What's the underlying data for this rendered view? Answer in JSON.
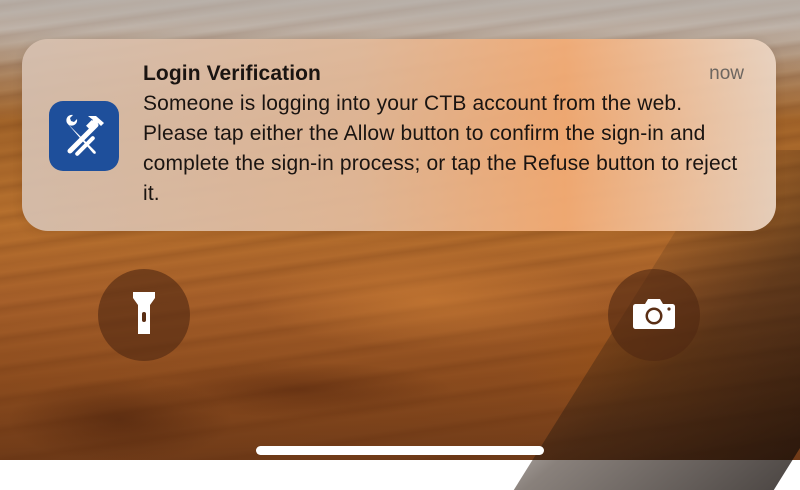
{
  "notification": {
    "app_icon": "tools-wrench-hammer-icon",
    "title": "Login Verification",
    "time": "now",
    "body": "Someone is logging into your CTB account from the web. Please tap either the Allow button to confirm the sign-in and complete the sign-in process; or tap the Refuse button to reject it."
  },
  "lock_screen": {
    "left_button_icon": "flashlight-icon",
    "right_button_icon": "camera-icon"
  },
  "colors": {
    "app_icon_background": "#1e4f9b",
    "title_text": "#1a1411",
    "time_text": "#6d6660",
    "home_indicator": "#ffffff"
  }
}
